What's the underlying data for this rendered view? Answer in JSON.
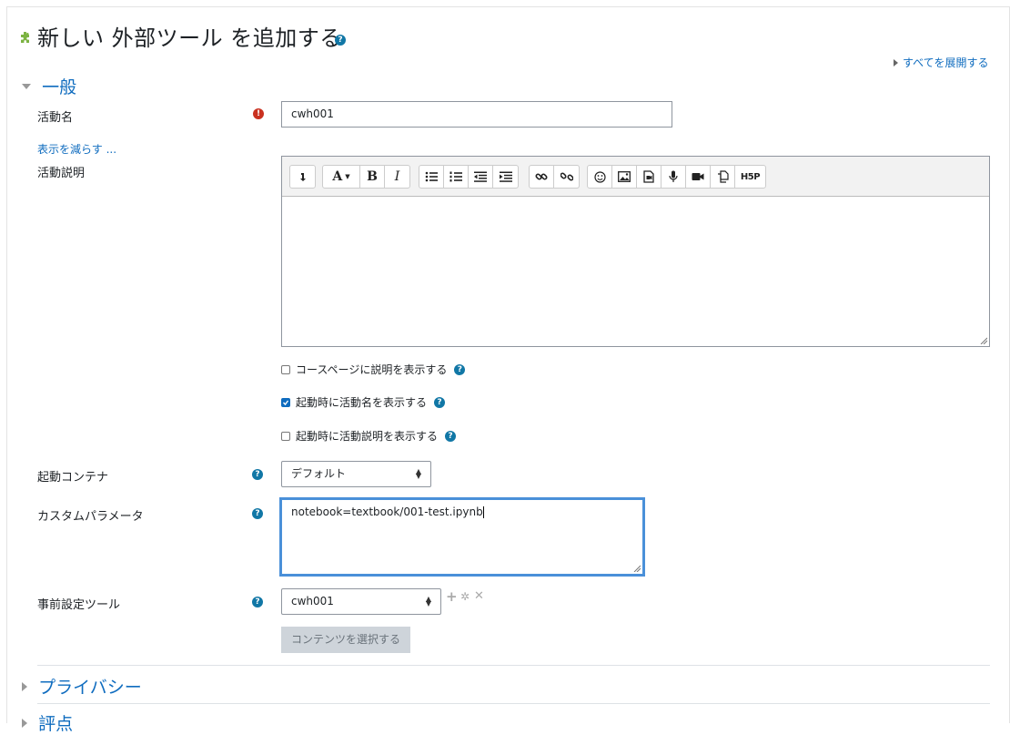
{
  "page": {
    "title": "新しい 外部ツール を追加する",
    "expand_all": "すべてを展開する"
  },
  "general": {
    "section_title": "一般",
    "activity_name_label": "活動名",
    "activity_name_value": "cwh001",
    "show_less": "表示を減らす ...",
    "description_label": "活動説明",
    "checkboxes": [
      {
        "label": "コースページに説明を表示する",
        "checked": false
      },
      {
        "label": "起動時に活動名を表示する",
        "checked": true
      },
      {
        "label": "起動時に活動説明を表示する",
        "checked": false
      }
    ],
    "launch_container_label": "起動コンテナ",
    "launch_container_value": "デフォルト",
    "custom_params_label": "カスタムパラメータ",
    "custom_params_value": "notebook=textbook/001-test.ipynb",
    "preconfigured_tool_label": "事前設定ツール",
    "preconfigured_tool_value": "cwh001",
    "select_content_button": "コンテンツを選択する"
  },
  "editor_toolbar": {
    "groups": [
      [
        "expand-toolbar-icon"
      ],
      [
        "font-style-icon",
        "bold-icon",
        "italic-icon"
      ],
      [
        "unordered-list-icon",
        "ordered-list-icon",
        "outdent-icon",
        "indent-icon"
      ],
      [
        "link-icon",
        "unlink-icon"
      ],
      [
        "emoji-icon",
        "image-icon",
        "media-icon",
        "record-audio-icon",
        "record-video-icon",
        "manage-files-icon",
        "h5p-icon"
      ]
    ],
    "h5p_label": "H5P"
  },
  "sections": [
    {
      "title": "プライバシー"
    },
    {
      "title": "評点"
    }
  ],
  "colors": {
    "link": "#0f6cbf",
    "help": "#1177a6",
    "required": "#ca3120",
    "focus": "#4a90d9"
  }
}
